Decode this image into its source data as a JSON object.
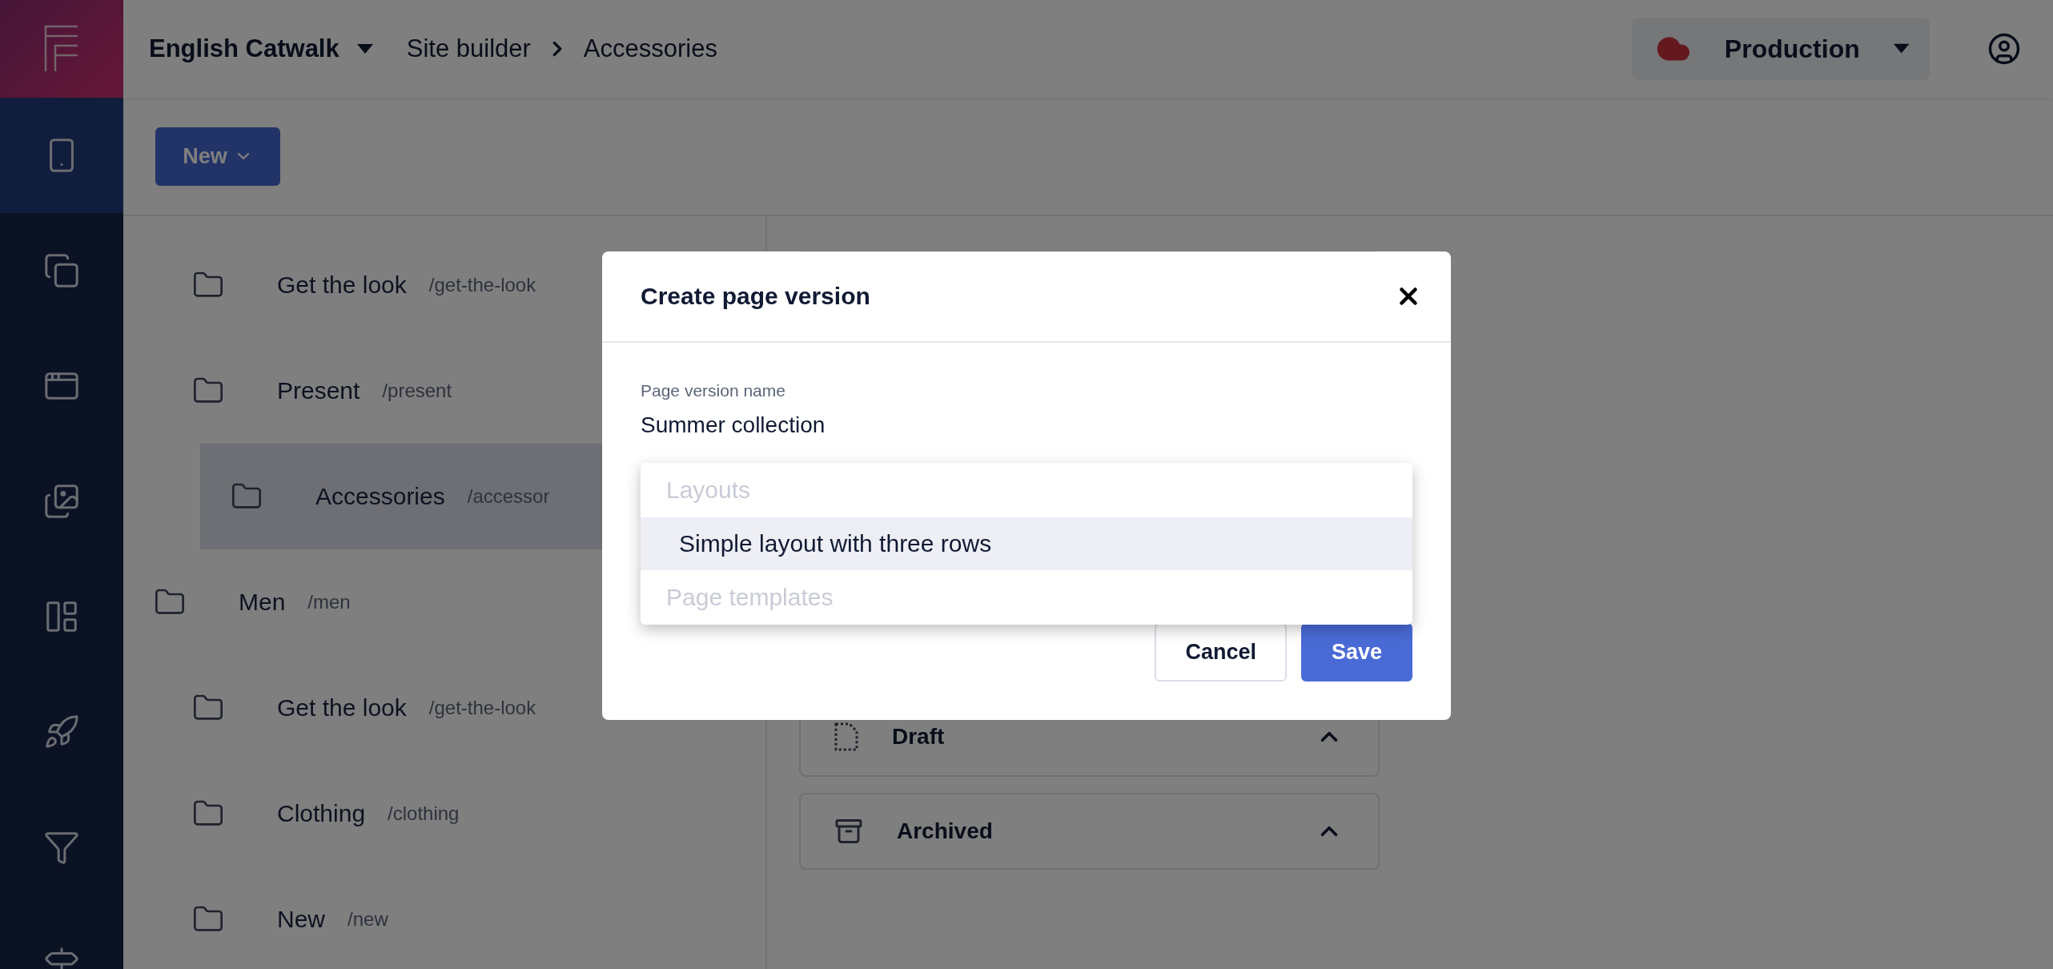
{
  "header": {
    "workspace": "English Catwalk",
    "breadcrumbs": [
      "Site builder",
      "Accessories"
    ],
    "environment": "Production"
  },
  "sidebar": {
    "items": [
      {
        "selected": true
      },
      {
        "selected": false
      },
      {
        "selected": false
      },
      {
        "selected": false
      },
      {
        "selected": false
      },
      {
        "selected": false
      },
      {
        "selected": false
      },
      {
        "selected": false
      }
    ]
  },
  "toolbar": {
    "new_button": "New"
  },
  "tree": {
    "items": [
      {
        "children": [
          {
            "label": "Get the look",
            "path": "/get-the-look",
            "selected": false
          },
          {
            "label": "Present",
            "path": "/present",
            "selected": false,
            "children": [
              {
                "label": "Accessories",
                "path": "/accessor",
                "selected": true
              }
            ]
          }
        ]
      },
      {
        "label": "Men",
        "path": "/men",
        "selected": false,
        "children": [
          {
            "label": "Get the look",
            "path": "/get-the-look",
            "selected": false
          },
          {
            "label": "Clothing",
            "path": "/clothing",
            "selected": false
          },
          {
            "label": "New",
            "path": "/new",
            "selected": false
          }
        ]
      }
    ]
  },
  "versions": {
    "cards": [
      {
        "kind": "draft",
        "title": "Draft"
      },
      {
        "kind": "archived",
        "title": "Archived"
      }
    ]
  },
  "modal": {
    "title": "Create page version",
    "field": {
      "label": "Page version name",
      "value": "Summer collection"
    },
    "dropdown": {
      "groups": [
        {
          "label": "Layouts",
          "options": [
            {
              "label": "Simple layout with three rows",
              "selected": true
            }
          ]
        },
        {
          "label": "Page templates"
        }
      ]
    },
    "buttons": [
      {
        "label": "Cancel",
        "kind": "secondary"
      },
      {
        "label": "Save",
        "kind": "primary"
      }
    ]
  }
}
